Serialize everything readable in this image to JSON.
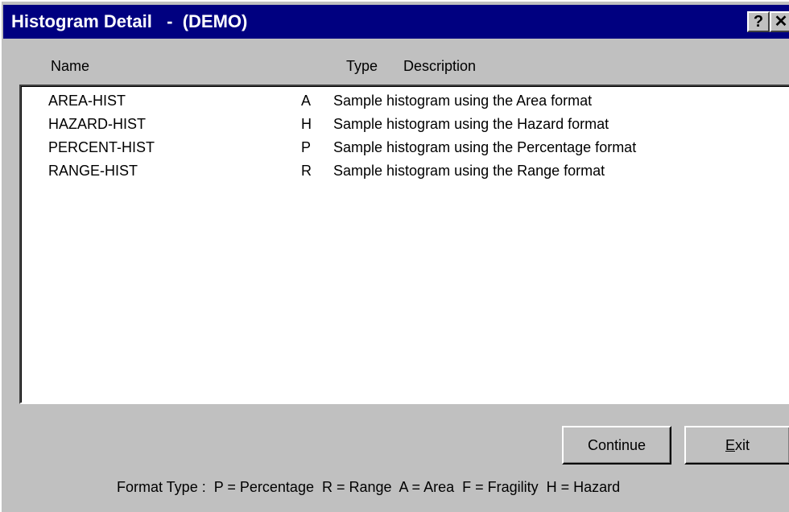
{
  "window": {
    "title": "Histogram Detail   -  (DEMO)",
    "help_button": "?",
    "close_button": "✕"
  },
  "columns": {
    "name": "Name",
    "type": "Type",
    "description": "Description"
  },
  "rows": [
    {
      "name": "AREA-HIST",
      "type": "A",
      "description": "Sample histogram using the Area format"
    },
    {
      "name": "HAZARD-HIST",
      "type": "H",
      "description": "Sample histogram using the Hazard format"
    },
    {
      "name": "PERCENT-HIST",
      "type": "P",
      "description": "Sample histogram using the Percentage format"
    },
    {
      "name": "RANGE-HIST",
      "type": "R",
      "description": "Sample histogram using the Range format"
    }
  ],
  "buttons": {
    "continue_label": "Continue",
    "exit_hotkey": "E",
    "exit_rest": "xit"
  },
  "legend": "Format Type :  P = Percentage  R = Range  A = Area  F = Fragility  H = Hazard",
  "colors": {
    "titlebar": "#000080",
    "face": "#c0c0c0",
    "list_bg": "#ffffff"
  }
}
